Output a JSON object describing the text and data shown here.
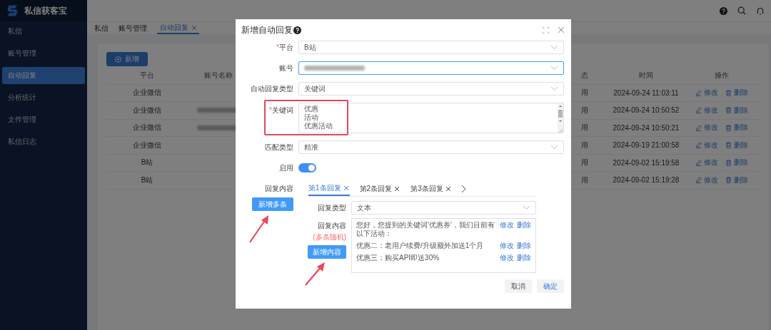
{
  "app": {
    "name": "私信获客宝"
  },
  "sidebar": {
    "items": [
      {
        "label": "私信",
        "selected": false
      },
      {
        "label": "账号管理",
        "selected": false
      },
      {
        "label": "自动回复",
        "selected": true
      },
      {
        "label": "分析统计",
        "selected": false
      },
      {
        "label": "文件管理",
        "selected": false
      },
      {
        "label": "私信日志",
        "selected": false
      }
    ]
  },
  "tabs": [
    {
      "label": "私信",
      "selected": false,
      "closable": false
    },
    {
      "label": "账号管理",
      "selected": false,
      "closable": false
    },
    {
      "label": "自动回复",
      "selected": true,
      "closable": true
    }
  ],
  "toolbar": {
    "add_button": "新增"
  },
  "table": {
    "columns": [
      "平台",
      "账号名称",
      "态",
      "时间",
      "操作"
    ],
    "rows": [
      {
        "platform": "企业微信",
        "status": "用",
        "time": "2024-09-24 11:03:11",
        "actions": [
          "修改",
          "删除"
        ]
      },
      {
        "platform": "企业微信",
        "account_redacted": true,
        "status": "用",
        "time": "2024-09-24 10:50:52",
        "actions": [
          "修改",
          "删除"
        ]
      },
      {
        "platform": "企业微信",
        "account_redacted": true,
        "status": "用",
        "time": "2024-09-24 10:50:21",
        "actions": [
          "修改",
          "删除"
        ]
      },
      {
        "platform": "企业微信",
        "status": "用",
        "time": "2024-09-19 21:00:58",
        "actions": [
          "修改",
          "删除"
        ]
      },
      {
        "platform": "B站",
        "status": "用",
        "time": "2024-09-02 15:19:58",
        "actions": [
          "修改",
          "删除"
        ]
      },
      {
        "platform": "B站",
        "status": "用",
        "time": "2024-09-02 15:19:28",
        "actions": [
          "修改",
          "删除"
        ]
      }
    ]
  },
  "dialog": {
    "title": "新增自动回复",
    "fields": [
      {
        "kind": "select",
        "label": "平台",
        "required_mark": "*",
        "value": "B站",
        "focused": false
      },
      {
        "kind": "select",
        "label": "账号",
        "redacted": true,
        "focused": true
      },
      {
        "kind": "select",
        "label": "自动回复类型",
        "value": "关键词",
        "focused": false
      },
      {
        "kind": "textarea",
        "label": "关键词",
        "required_mark": "*",
        "lines": [
          "优惠",
          "活动",
          "优惠活动"
        ],
        "highlighted": true
      },
      {
        "kind": "select",
        "label": "匹配类型",
        "value": "精准",
        "focused": false
      },
      {
        "kind": "switch",
        "label": "启用",
        "on": true
      }
    ],
    "reply": {
      "label": "回复内容",
      "add_button": {
        "label": "新增多条",
        "arrow": true
      },
      "tabs": [
        {
          "label": "第1条回复",
          "selected": true
        },
        {
          "label": "第2条回复",
          "selected": false
        },
        {
          "label": "第3条回复",
          "selected": false
        }
      ],
      "type_label": "回复类型",
      "type_value": "文本",
      "content_label": "回复内容",
      "content_hint": "(多条随机)",
      "add_content_button": {
        "label": "新增内容",
        "arrow": true
      },
      "items": [
        {
          "text": "您好，您提到的关键词'优惠券'，我们目前有以下活动：",
          "actions": [
            "修改",
            "删除"
          ]
        },
        {
          "text": "优惠二：老用户续费/升级额外加送1个月",
          "actions": [
            "修改",
            "删除"
          ]
        },
        {
          "text": "优惠三：购买API即送30%",
          "actions": [
            "修改",
            "删除"
          ]
        }
      ]
    },
    "buttons": [
      {
        "label": "取消",
        "kind": "secondary"
      },
      {
        "label": "确定",
        "kind": "primary"
      }
    ]
  }
}
